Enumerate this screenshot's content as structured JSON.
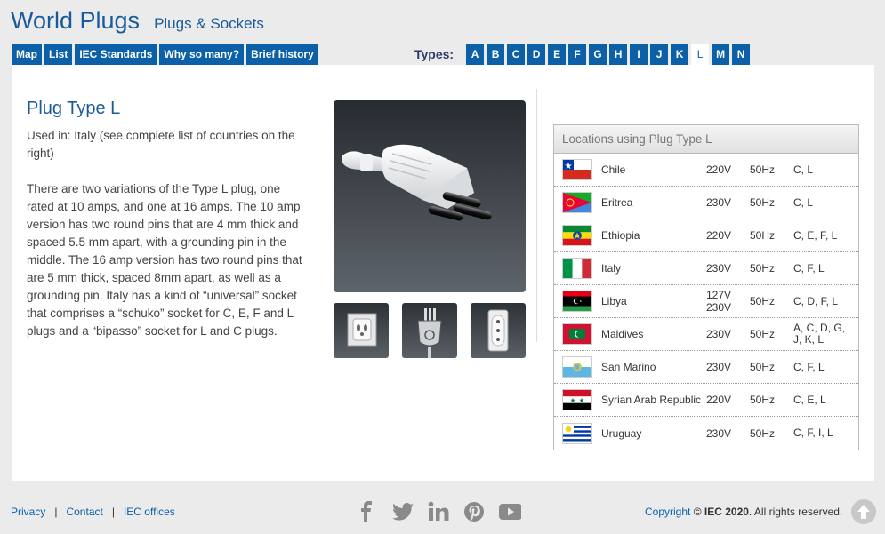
{
  "header": {
    "title": "World Plugs",
    "subtitle": "Plugs & Sockets"
  },
  "nav": [
    "Map",
    "List",
    "IEC Standards",
    "Why so many?",
    "Brief history"
  ],
  "types": {
    "label": "Types:",
    "letters": [
      "A",
      "B",
      "C",
      "D",
      "E",
      "F",
      "G",
      "H",
      "I",
      "J",
      "K",
      "L",
      "M",
      "N"
    ],
    "active": "L"
  },
  "content": {
    "title": "Plug Type L",
    "used_in": "Used in: Italy (see complete list of countries on the right)",
    "description": "There are two variations of the Type L plug, one rated at 10 amps, and one at 16 amps. The 10 amp version has two round pins that are 4 mm thick and spaced 5.5 mm apart, with a grounding pin in the middle. The 16 amp version has two round pins that are 5 mm thick, spaced 8mm apart, as well as a grounding pin. Italy has a kind of “universal” socket that comprises a “schuko” socket for C, E, F and L plugs and a “bipasso” socket for L and C plugs."
  },
  "images": {
    "main": "type-l-plug-photo",
    "thumbnails": [
      "socket-icon",
      "plug-icon",
      "outlet-icon"
    ]
  },
  "locations": {
    "header": "Locations using Plug Type L",
    "rows": [
      {
        "country": "Chile",
        "voltage": "220V",
        "frequency": "50Hz",
        "types": "C, L",
        "flag": "chile-flag"
      },
      {
        "country": "Eritrea",
        "voltage": "230V",
        "frequency": "50Hz",
        "types": "C, L",
        "flag": "eritrea-flag"
      },
      {
        "country": "Ethiopia",
        "voltage": "220V",
        "frequency": "50Hz",
        "types": "C, E, F, L",
        "flag": "ethiopia-flag"
      },
      {
        "country": "Italy",
        "voltage": "230V",
        "frequency": "50Hz",
        "types": "C, F, L",
        "flag": "italy-flag"
      },
      {
        "country": "Libya",
        "voltage": "127V 230V",
        "frequency": "50Hz",
        "types": "C, D, F, L",
        "flag": "libya-flag"
      },
      {
        "country": "Maldives",
        "voltage": "230V",
        "frequency": "50Hz",
        "types": "A, C, D, G, J, K, L",
        "flag": "maldives-flag"
      },
      {
        "country": "San Marino",
        "voltage": "230V",
        "frequency": "50Hz",
        "types": "C, F, L",
        "flag": "san-marino-flag"
      },
      {
        "country": "Syrian Arab Republic",
        "voltage": "220V",
        "frequency": "50Hz",
        "types": "C, E, L",
        "flag": "syria-flag"
      },
      {
        "country": "Uruguay",
        "voltage": "230V",
        "frequency": "50Hz",
        "types": "C, F, I, L",
        "flag": "uruguay-flag"
      }
    ]
  },
  "footer": {
    "links": [
      "Privacy",
      "Contact",
      "IEC offices"
    ],
    "social": [
      "facebook-icon",
      "twitter-icon",
      "linkedin-icon",
      "pinterest-icon",
      "youtube-icon"
    ],
    "copyright_prefix": "Copyright",
    "copyright_brand": "© IEC 2020",
    "copyright_suffix": ". All rights reserved."
  }
}
